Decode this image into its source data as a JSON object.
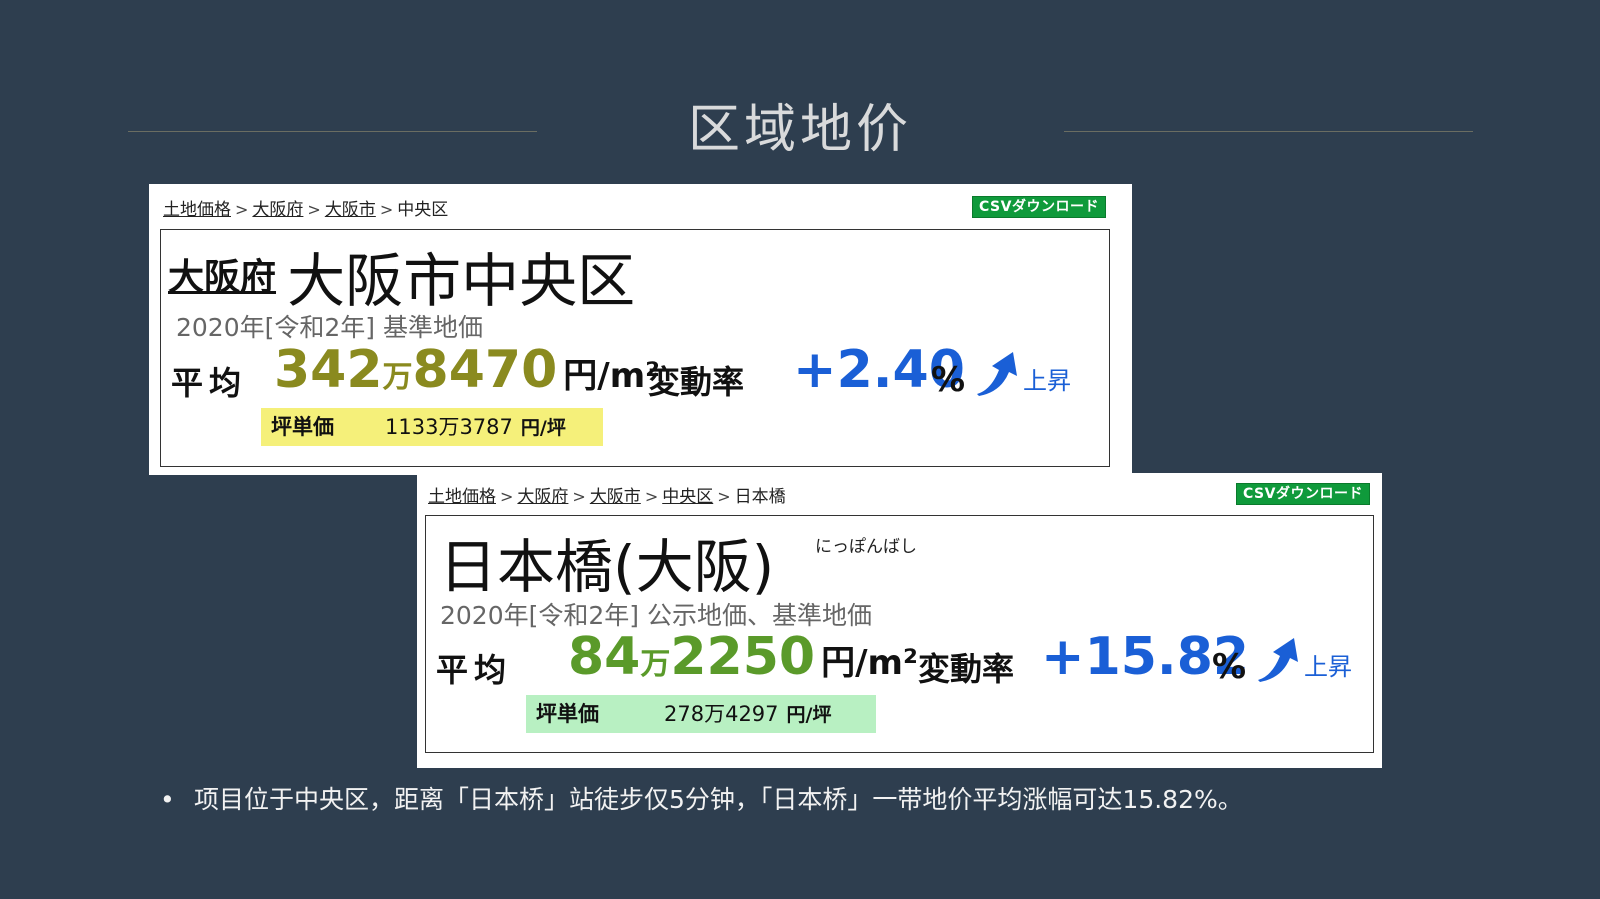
{
  "slide": {
    "title": "区域地价"
  },
  "card1": {
    "breadcrumb": [
      "土地価格",
      "大阪府",
      "大阪市"
    ],
    "breadcrumb_current": "中央区",
    "csv_label": "CSVダウンロード",
    "prefecture": "大阪府",
    "area": "大阪市中央区",
    "year_line": "2020年[令和2年] 基準地価",
    "avg_label": "平均",
    "price_a": "342",
    "price_man": "万",
    "price_b": "8470",
    "unit": "円/m²",
    "rate_label": "変動率",
    "rate": "+2.40",
    "pct": "%",
    "trend": "上昇",
    "tsubo_label": "坪単価",
    "tsubo_value": "1133万3787",
    "tsubo_unit": "円/坪",
    "price_color": "#8a8a1f",
    "tsubo_bg": "#f5f07a"
  },
  "card2": {
    "breadcrumb": [
      "土地価格",
      "大阪府",
      "大阪市",
      "中央区"
    ],
    "breadcrumb_current": "日本橋",
    "csv_label": "CSVダウンロード",
    "area": "日本橋(大阪)",
    "furigana": "にっぽんばし",
    "year_line": "2020年[令和2年] 公示地価、基準地価",
    "avg_label": "平均",
    "price_a": "84",
    "price_man": "万",
    "price_b": "2250",
    "unit": "円/m²",
    "rate_label": "変動率",
    "rate": "+15.82",
    "pct": "%",
    "trend": "上昇",
    "tsubo_label": "坪単価",
    "tsubo_value": "278万4297",
    "tsubo_unit": "円/坪",
    "price_color": "#5a9a2a",
    "tsubo_bg": "#b8f0c2"
  },
  "bullet": {
    "text": "项目位于中央区，距离「日本桥」站徒步仅5分钟，「日本桥」一带地价平均涨幅可达15.82%。"
  },
  "icons": {
    "trend": "up-arrow-icon",
    "bullet": "bullet-dot"
  }
}
